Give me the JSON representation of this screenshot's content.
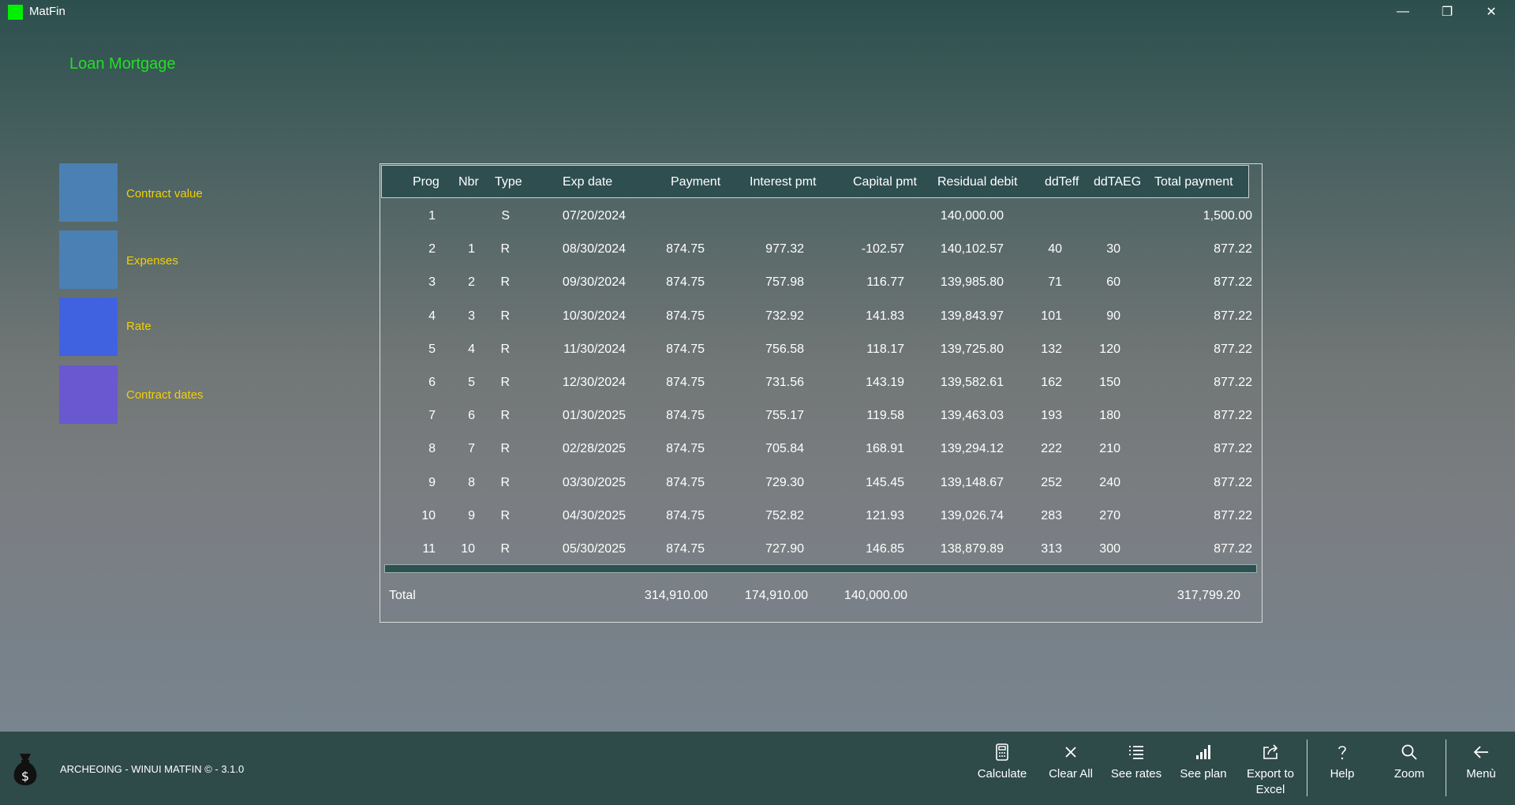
{
  "window": {
    "title": "MatFin",
    "minimize_glyph": "—",
    "maximize_glyph": "❐",
    "close_glyph": "✕"
  },
  "page": {
    "title": "Loan Mortgage"
  },
  "tiles": [
    {
      "label": "Contract value",
      "color": "#4a80b4"
    },
    {
      "label": "Expenses",
      "color": "#4a80b4"
    },
    {
      "label": "Rate",
      "color": "#4062e0"
    },
    {
      "label": "Contract dates",
      "color": "#6a58d0"
    }
  ],
  "table": {
    "headers": [
      "Prog",
      "Nbr",
      "Type",
      "Exp date",
      "Payment",
      "Interest pmt",
      "Capital pmt",
      "Residual debit",
      "ddTeff",
      "ddTAEG",
      "Total payment"
    ],
    "rows": [
      [
        "1",
        "",
        "S",
        "07/20/2024",
        "",
        "",
        "",
        "140,000.00",
        "",
        "",
        "1,500.00"
      ],
      [
        "2",
        "1",
        "R",
        "08/30/2024",
        "874.75",
        "977.32",
        "-102.57",
        "140,102.57",
        "40",
        "30",
        "877.22"
      ],
      [
        "3",
        "2",
        "R",
        "09/30/2024",
        "874.75",
        "757.98",
        "116.77",
        "139,985.80",
        "71",
        "60",
        "877.22"
      ],
      [
        "4",
        "3",
        "R",
        "10/30/2024",
        "874.75",
        "732.92",
        "141.83",
        "139,843.97",
        "101",
        "90",
        "877.22"
      ],
      [
        "5",
        "4",
        "R",
        "11/30/2024",
        "874.75",
        "756.58",
        "118.17",
        "139,725.80",
        "132",
        "120",
        "877.22"
      ],
      [
        "6",
        "5",
        "R",
        "12/30/2024",
        "874.75",
        "731.56",
        "143.19",
        "139,582.61",
        "162",
        "150",
        "877.22"
      ],
      [
        "7",
        "6",
        "R",
        "01/30/2025",
        "874.75",
        "755.17",
        "119.58",
        "139,463.03",
        "193",
        "180",
        "877.22"
      ],
      [
        "8",
        "7",
        "R",
        "02/28/2025",
        "874.75",
        "705.84",
        "168.91",
        "139,294.12",
        "222",
        "210",
        "877.22"
      ],
      [
        "9",
        "8",
        "R",
        "03/30/2025",
        "874.75",
        "729.30",
        "145.45",
        "139,148.67",
        "252",
        "240",
        "877.22"
      ],
      [
        "10",
        "9",
        "R",
        "04/30/2025",
        "874.75",
        "752.82",
        "121.93",
        "139,026.74",
        "283",
        "270",
        "877.22"
      ],
      [
        "11",
        "10",
        "R",
        "05/30/2025",
        "874.75",
        "727.90",
        "146.85",
        "138,879.89",
        "313",
        "300",
        "877.22"
      ]
    ],
    "totals": {
      "label": "Total",
      "payment": "314,910.00",
      "interest": "174,910.00",
      "capital": "140,000.00",
      "total_payment": "317,799.20"
    }
  },
  "footer": {
    "text": "ARCHEOING - WINUI MATFIN © - 3.1.0"
  },
  "commands": [
    {
      "label": "Calculate",
      "icon": "calculator-icon"
    },
    {
      "label": "Clear All",
      "icon": "close-icon"
    },
    {
      "label": "See rates",
      "icon": "list-icon"
    },
    {
      "label": "See plan",
      "icon": "bar-chart-icon"
    },
    {
      "label": "Export to Excel",
      "icon": "share-icon"
    },
    {
      "label": "Help",
      "icon": "help-icon"
    },
    {
      "label": "Zoom",
      "icon": "search-icon"
    },
    {
      "label": "Menù",
      "icon": "back-arrow-icon"
    }
  ]
}
